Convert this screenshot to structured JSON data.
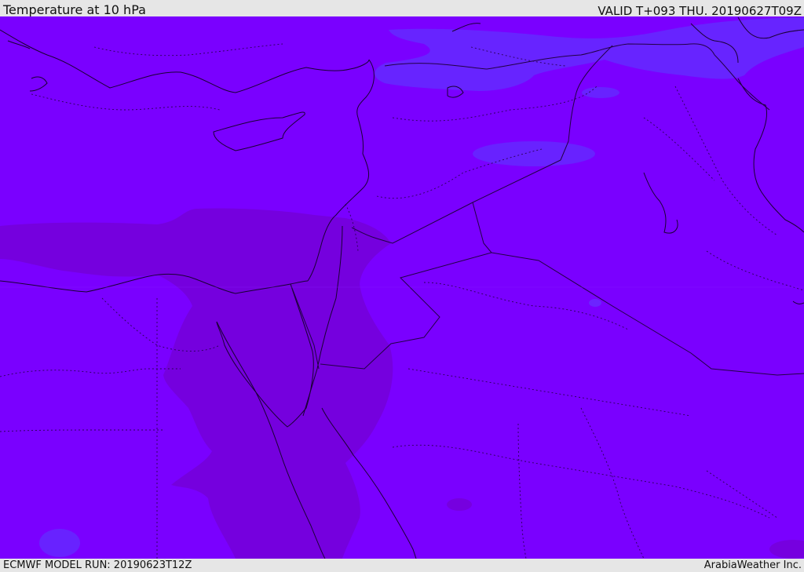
{
  "header": {
    "title": "Temperature at 10 hPa",
    "valid_time": "VALID T+093 THU. 20190627T09Z"
  },
  "footer": {
    "model_run": "ECMWF MODEL RUN: 20190623T12Z",
    "brand": "ArabiaWeather Inc."
  },
  "map": {
    "colors": {
      "base_field": "#7a00ff",
      "warm_field": "#7700dd",
      "cool_field": "#6a2aff",
      "coastline": "#1a0033",
      "border": "#220044"
    }
  }
}
